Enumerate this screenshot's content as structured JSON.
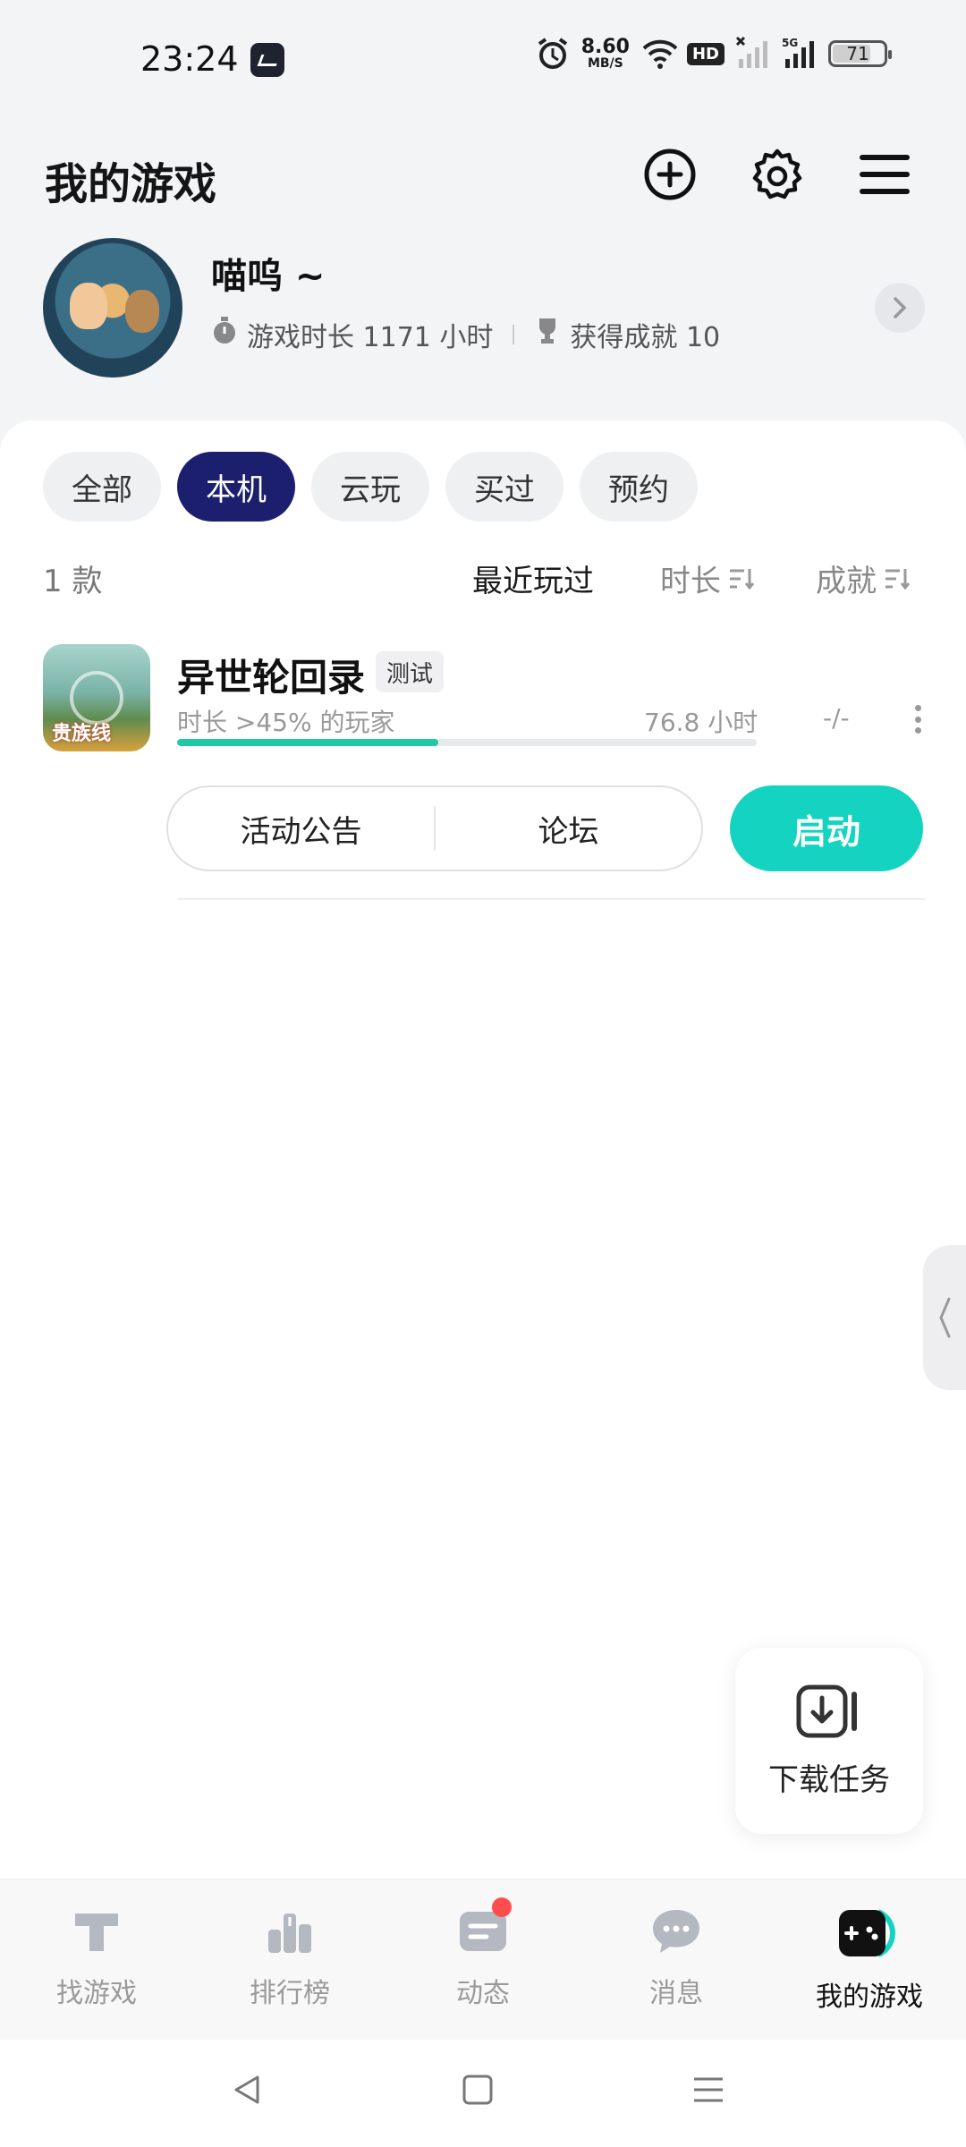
{
  "status": {
    "time": "23:24",
    "net_speed_value": "8.60",
    "net_speed_unit": "MB/S",
    "hd_label": "HD",
    "battery": "71"
  },
  "header": {
    "title": "我的游戏"
  },
  "profile": {
    "username": "喵呜 ~",
    "play_time": "游戏时长 1171 小时",
    "achievements": "获得成就 10"
  },
  "filters": {
    "tabs": [
      "全部",
      "本机",
      "云玩",
      "买过",
      "预约"
    ],
    "active": "本机"
  },
  "list": {
    "count": "1 款",
    "sort_recent": "最近玩过",
    "sort_duration": "时长",
    "sort_achievements": "成就"
  },
  "game": {
    "title": "异世轮回录",
    "tag": "测试",
    "icon_badge": "贵族线",
    "percentile": "时长 >45% 的玩家",
    "hours": "76.8 小时",
    "achievements": "-/-",
    "progress": 0.45,
    "actions": [
      "活动公告",
      "论坛"
    ],
    "launch": "启动"
  },
  "download_task": {
    "label": "下载任务"
  },
  "bottom_nav": [
    {
      "label": "找游戏",
      "icon": "find-game-icon"
    },
    {
      "label": "排行榜",
      "icon": "ranking-icon"
    },
    {
      "label": "动态",
      "icon": "feed-icon"
    },
    {
      "label": "消息",
      "icon": "message-icon"
    },
    {
      "label": "我的游戏",
      "icon": "my-games-icon"
    }
  ],
  "colors": {
    "accent": "#14d3c0",
    "active_chip": "#1c1f6e",
    "progress": "#1ec9a6",
    "badge_dot": "#ff4d4f"
  }
}
